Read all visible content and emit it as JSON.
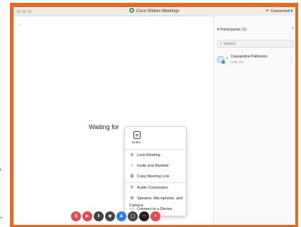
{
  "window": {
    "title": "Cisco Webex Meetings",
    "status": "Connected"
  },
  "stage": {
    "waiting_text": "Waiting for"
  },
  "participants_panel": {
    "header": "Participants (1)",
    "search_placeholder": "Search",
    "participants": [
      {
        "name": "Cassandra Patterson",
        "role": "Host, me"
      }
    ]
  },
  "menu": {
    "notes_label": "Notes",
    "items": [
      {
        "label": "Lock Meeting",
        "icon": "lock-icon",
        "glyph": "⊘"
      },
      {
        "label": "Invite and Remind",
        "icon": "person-icon",
        "glyph": "♀"
      },
      {
        "label": "Copy Meeting Link",
        "icon": "link-icon",
        "glyph": "⧉"
      },
      {
        "label": "Audio Connection",
        "icon": "phone-icon",
        "glyph": "✆"
      },
      {
        "label": "Speaker, Microphone, and Camera",
        "icon": "gear-icon",
        "glyph": "⚙"
      },
      {
        "label": "Connect to a Device",
        "icon": "device-icon",
        "glyph": "▭"
      }
    ]
  },
  "controls": [
    {
      "name": "mute-button",
      "icon": "microphone-icon",
      "glyph": "🎙",
      "color": "#e5484d"
    },
    {
      "name": "video-button",
      "icon": "camera-icon",
      "glyph": "▶",
      "color": "#e5484d"
    },
    {
      "name": "share-button",
      "icon": "share-icon",
      "glyph": "⬆",
      "color": "#444444"
    },
    {
      "name": "record-button",
      "icon": "record-icon",
      "glyph": "◉",
      "color": "#444444"
    },
    {
      "name": "participants-button",
      "icon": "participants-icon",
      "glyph": "♟",
      "color": "#2b7de9"
    },
    {
      "name": "chat-button",
      "icon": "chat-icon",
      "glyph": "◯",
      "color": "#444444"
    },
    {
      "name": "more-button",
      "icon": "more-icon",
      "glyph": "⋯",
      "color": "#222222"
    },
    {
      "name": "leave-button",
      "icon": "close-icon",
      "glyph": "✕",
      "color": "#e5484d"
    }
  ]
}
